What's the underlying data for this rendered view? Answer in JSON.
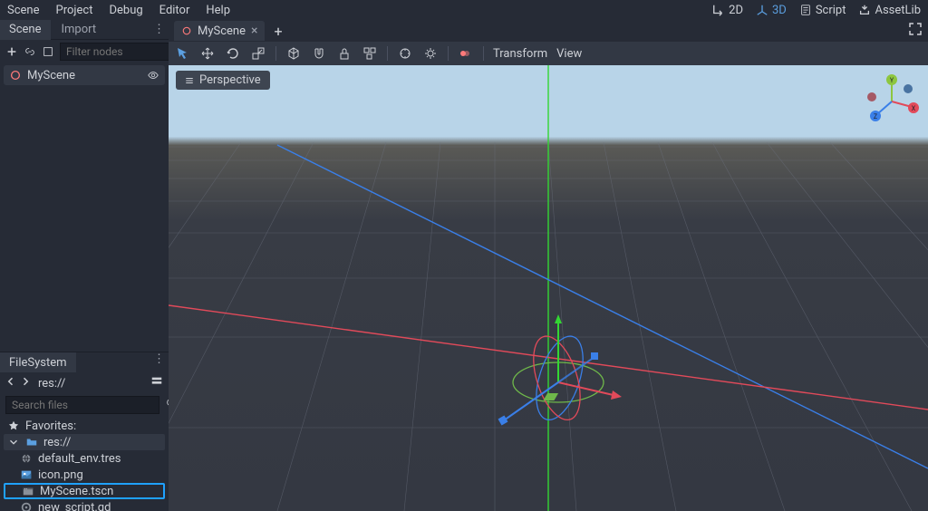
{
  "menu": {
    "items": [
      "Scene",
      "Project",
      "Debug",
      "Editor",
      "Help"
    ]
  },
  "modes": {
    "mode_2d": "2D",
    "mode_3d": "3D",
    "script": "Script",
    "assetlib": "AssetLib"
  },
  "scene_dock": {
    "tab_scene": "Scene",
    "tab_import": "Import",
    "filter_placeholder": "Filter nodes",
    "root_node": "MyScene"
  },
  "filesystem": {
    "tab": "FileSystem",
    "path": "res://",
    "search_placeholder": "Search files",
    "favorites_label": "Favorites:",
    "root_label": "res://",
    "files": [
      "default_env.tres",
      "icon.png",
      "MyScene.tscn",
      "new_script.gd"
    ]
  },
  "editor": {
    "tab_name": "MyScene",
    "perspective_label": "Perspective",
    "transform_btn": "Transform",
    "view_btn": "View"
  }
}
